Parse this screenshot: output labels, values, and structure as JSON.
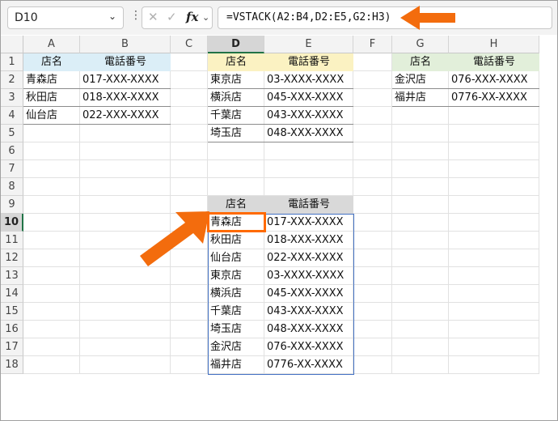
{
  "name_box": {
    "value": "D10",
    "caret": "⌄"
  },
  "formula_bar": {
    "more_icon": "⋮",
    "cancel_glyph": "✕",
    "enter_glyph": "✓",
    "fx_label": "fx",
    "fx_caret": "⌄",
    "formula": "=VSTACK(A2:B4,D2:E5,G2:H3)"
  },
  "columns": [
    "A",
    "B",
    "C",
    "D",
    "E",
    "F",
    "G",
    "H"
  ],
  "rows": [
    "1",
    "2",
    "3",
    "4",
    "5",
    "6",
    "7",
    "8",
    "9",
    "10",
    "11",
    "12",
    "13",
    "14",
    "15",
    "16",
    "17",
    "18"
  ],
  "selected_column": "D",
  "selected_row": "10",
  "headers": {
    "name": "店名",
    "phone": "電話番号"
  },
  "table_a": [
    {
      "name": "青森店",
      "phone": "017-XXX-XXXX"
    },
    {
      "name": "秋田店",
      "phone": "018-XXX-XXXX"
    },
    {
      "name": "仙台店",
      "phone": "022-XXX-XXXX"
    }
  ],
  "table_d": [
    {
      "name": "東京店",
      "phone": "03-XXXX-XXXX"
    },
    {
      "name": "横浜店",
      "phone": "045-XXX-XXXX"
    },
    {
      "name": "千葉店",
      "phone": "043-XXX-XXXX"
    },
    {
      "name": "埼玉店",
      "phone": "048-XXX-XXXX"
    }
  ],
  "table_g": [
    {
      "name": "金沢店",
      "phone": "076-XXX-XXXX"
    },
    {
      "name": "福井店",
      "phone": "0776-XX-XXXX"
    }
  ],
  "result": [
    {
      "name": "青森店",
      "phone": "017-XXX-XXXX"
    },
    {
      "name": "秋田店",
      "phone": "018-XXX-XXXX"
    },
    {
      "name": "仙台店",
      "phone": "022-XXX-XXXX"
    },
    {
      "name": "東京店",
      "phone": "03-XXXX-XXXX"
    },
    {
      "name": "横浜店",
      "phone": "045-XXX-XXXX"
    },
    {
      "name": "千葉店",
      "phone": "043-XXX-XXXX"
    },
    {
      "name": "埼玉店",
      "phone": "048-XXX-XXXX"
    },
    {
      "name": "金沢店",
      "phone": "076-XXX-XXXX"
    },
    {
      "name": "福井店",
      "phone": "0776-XX-XXXX"
    }
  ],
  "colors": {
    "accent_arrow": "#f36c0d",
    "highlight": "#ff6a00",
    "spill_border": "#4472c4",
    "table_a_header": "#dbeef7",
    "table_d_header": "#fbf2c2",
    "table_g_header": "#e2efda",
    "result_header": "#d9d9d9"
  }
}
